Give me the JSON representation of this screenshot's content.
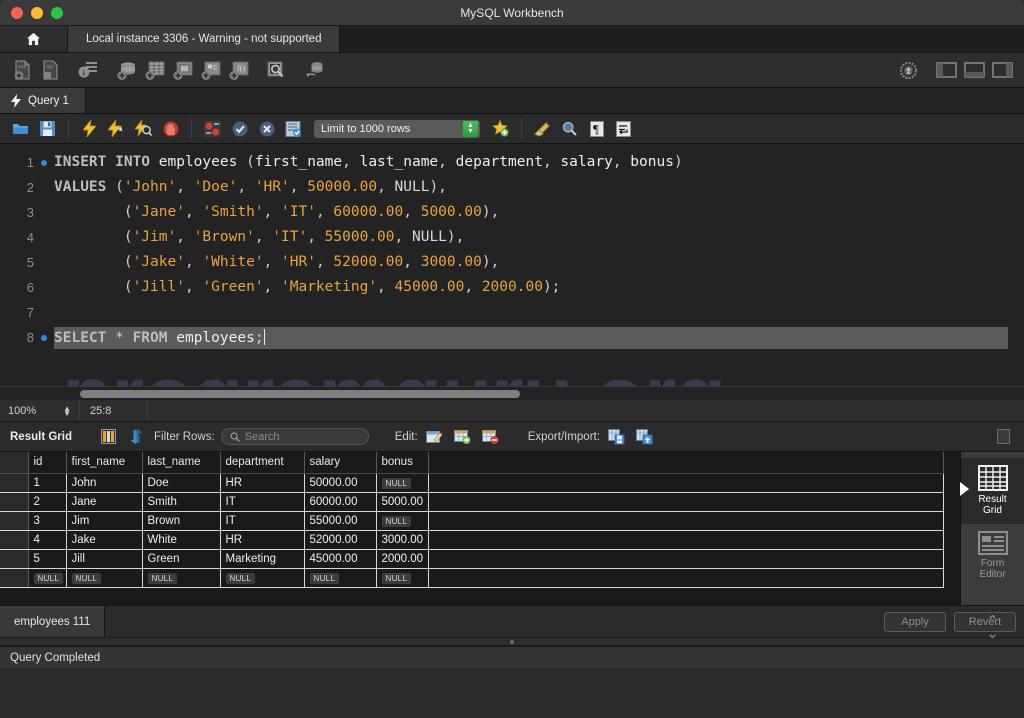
{
  "window": {
    "title": "MySQL Workbench",
    "traffic_lights": [
      "close",
      "minimize",
      "maximize"
    ]
  },
  "connection_bar": {
    "home_icon": "home-icon",
    "tab_label": "Local instance 3306 - Warning - not supported"
  },
  "main_toolbar": {
    "icons": [
      "new-sql-file-icon",
      "open-sql-file-icon",
      "server-info-icon",
      "new-schema-icon",
      "new-table-icon",
      "new-view-icon",
      "new-procedure-icon",
      "new-function-icon",
      "search-data-icon",
      "reconnect-server-icon"
    ],
    "right_icons": [
      "settings-gear-icon",
      "toggle-sidebar-icon",
      "toggle-output-icon",
      "toggle-secondary-sidebar-icon"
    ]
  },
  "query_tab": {
    "icon": "lightning-icon",
    "label": "Query 1"
  },
  "query_toolbar": {
    "icons": [
      "open-script-icon",
      "save-script-icon",
      "execute-statement-icon",
      "execute-current-statement-icon",
      "explain-statement-icon",
      "stop-execution-icon",
      "toggle-breakpoint-icon",
      "commit-icon",
      "rollback-icon",
      "autocommit-icon"
    ],
    "limit_label": "Limit to 1000 rows",
    "right_icons": [
      "beautify-query-icon",
      "clear-query-icon",
      "find-icon",
      "toggle-invisible-chars-icon",
      "wrap-lines-icon"
    ]
  },
  "editor": {
    "watermark": "programguru.org",
    "lines": [
      {
        "num": "1",
        "marker": true,
        "current": false,
        "tokens": [
          {
            "t": "kw",
            "v": "INSERT INTO "
          },
          {
            "t": "ident",
            "v": "employees "
          },
          {
            "t": "punct",
            "v": "("
          },
          {
            "t": "ident",
            "v": "first_name"
          },
          {
            "t": "punct",
            "v": ", "
          },
          {
            "t": "ident",
            "v": "last_name"
          },
          {
            "t": "punct",
            "v": ", "
          },
          {
            "t": "ident",
            "v": "department"
          },
          {
            "t": "punct",
            "v": ", "
          },
          {
            "t": "ident",
            "v": "salary"
          },
          {
            "t": "punct",
            "v": ", "
          },
          {
            "t": "ident",
            "v": "bonus"
          },
          {
            "t": "punct",
            "v": ")"
          }
        ]
      },
      {
        "num": "2",
        "marker": false,
        "current": false,
        "tokens": [
          {
            "t": "kw",
            "v": "VALUES "
          },
          {
            "t": "punct",
            "v": "("
          },
          {
            "t": "str",
            "v": "'John'"
          },
          {
            "t": "punct",
            "v": ", "
          },
          {
            "t": "str",
            "v": "'Doe'"
          },
          {
            "t": "punct",
            "v": ", "
          },
          {
            "t": "str",
            "v": "'HR'"
          },
          {
            "t": "punct",
            "v": ", "
          },
          {
            "t": "num",
            "v": "50000.00"
          },
          {
            "t": "punct",
            "v": ", "
          },
          {
            "t": "nul",
            "v": "NULL"
          },
          {
            "t": "punct",
            "v": "),"
          }
        ]
      },
      {
        "num": "3",
        "marker": false,
        "current": false,
        "tokens": [
          {
            "t": "punct",
            "v": "        ("
          },
          {
            "t": "str",
            "v": "'Jane'"
          },
          {
            "t": "punct",
            "v": ", "
          },
          {
            "t": "str",
            "v": "'Smith'"
          },
          {
            "t": "punct",
            "v": ", "
          },
          {
            "t": "str",
            "v": "'IT'"
          },
          {
            "t": "punct",
            "v": ", "
          },
          {
            "t": "num",
            "v": "60000.00"
          },
          {
            "t": "punct",
            "v": ", "
          },
          {
            "t": "num",
            "v": "5000.00"
          },
          {
            "t": "punct",
            "v": "),"
          }
        ]
      },
      {
        "num": "4",
        "marker": false,
        "current": false,
        "tokens": [
          {
            "t": "punct",
            "v": "        ("
          },
          {
            "t": "str",
            "v": "'Jim'"
          },
          {
            "t": "punct",
            "v": ", "
          },
          {
            "t": "str",
            "v": "'Brown'"
          },
          {
            "t": "punct",
            "v": ", "
          },
          {
            "t": "str",
            "v": "'IT'"
          },
          {
            "t": "punct",
            "v": ", "
          },
          {
            "t": "num",
            "v": "55000.00"
          },
          {
            "t": "punct",
            "v": ", "
          },
          {
            "t": "nul",
            "v": "NULL"
          },
          {
            "t": "punct",
            "v": "),"
          }
        ]
      },
      {
        "num": "5",
        "marker": false,
        "current": false,
        "tokens": [
          {
            "t": "punct",
            "v": "        ("
          },
          {
            "t": "str",
            "v": "'Jake'"
          },
          {
            "t": "punct",
            "v": ", "
          },
          {
            "t": "str",
            "v": "'White'"
          },
          {
            "t": "punct",
            "v": ", "
          },
          {
            "t": "str",
            "v": "'HR'"
          },
          {
            "t": "punct",
            "v": ", "
          },
          {
            "t": "num",
            "v": "52000.00"
          },
          {
            "t": "punct",
            "v": ", "
          },
          {
            "t": "num",
            "v": "3000.00"
          },
          {
            "t": "punct",
            "v": "),"
          }
        ]
      },
      {
        "num": "6",
        "marker": false,
        "current": false,
        "tokens": [
          {
            "t": "punct",
            "v": "        ("
          },
          {
            "t": "str",
            "v": "'Jill'"
          },
          {
            "t": "punct",
            "v": ", "
          },
          {
            "t": "str",
            "v": "'Green'"
          },
          {
            "t": "punct",
            "v": ", "
          },
          {
            "t": "str",
            "v": "'Marketing'"
          },
          {
            "t": "punct",
            "v": ", "
          },
          {
            "t": "num",
            "v": "45000.00"
          },
          {
            "t": "punct",
            "v": ", "
          },
          {
            "t": "num",
            "v": "2000.00"
          },
          {
            "t": "punct",
            "v": ");"
          }
        ]
      },
      {
        "num": "7",
        "marker": false,
        "current": false,
        "tokens": []
      },
      {
        "num": "8",
        "marker": true,
        "current": true,
        "tokens": [
          {
            "t": "kw",
            "v": "SELECT "
          },
          {
            "t": "punct",
            "v": "* "
          },
          {
            "t": "kw",
            "v": "FROM "
          },
          {
            "t": "ident",
            "v": "employees"
          },
          {
            "t": "punct",
            "v": ";"
          }
        ]
      }
    ]
  },
  "editor_status": {
    "zoom": "100%",
    "position": "25:8"
  },
  "result_toolbar": {
    "title": "Result Grid",
    "grid_icon": "filter-columns-icon",
    "refresh_icon": "refresh-icon",
    "filter_label": "Filter Rows:",
    "search_placeholder": "Search",
    "search_icon": "search-icon",
    "edit_label": "Edit:",
    "edit_icons": [
      "edit-row-icon",
      "insert-row-icon",
      "delete-row-icon"
    ],
    "export_label": "Export/Import:",
    "export_icons": [
      "export-recordset-icon",
      "import-recordset-icon"
    ],
    "snapshot_icon": "wrap-cell-content-icon"
  },
  "result_grid": {
    "columns": [
      "id",
      "first_name",
      "last_name",
      "department",
      "salary",
      "bonus",
      ""
    ],
    "rows": [
      [
        "1",
        "John",
        "Doe",
        "HR",
        "50000.00",
        "NULL",
        ""
      ],
      [
        "2",
        "Jane",
        "Smith",
        "IT",
        "60000.00",
        "5000.00",
        ""
      ],
      [
        "3",
        "Jim",
        "Brown",
        "IT",
        "55000.00",
        "NULL",
        ""
      ],
      [
        "4",
        "Jake",
        "White",
        "HR",
        "52000.00",
        "3000.00",
        ""
      ],
      [
        "5",
        "Jill",
        "Green",
        "Marketing",
        "45000.00",
        "2000.00",
        ""
      ],
      [
        "NULL",
        "NULL",
        "NULL",
        "NULL",
        "NULL",
        "NULL",
        ""
      ]
    ]
  },
  "side_panel": {
    "items": [
      {
        "label": "Result\nGrid",
        "icon": "result-grid-icon",
        "active": true
      },
      {
        "label": "Form\nEditor",
        "icon": "form-editor-icon",
        "active": false
      }
    ],
    "chevrons_icon": "expand-collapse-chevrons-icon"
  },
  "bottom_tabs": {
    "tab_label": "employees 111",
    "apply_label": "Apply",
    "revert_label": "Revert"
  },
  "statusbar": {
    "message": "Query Completed"
  }
}
